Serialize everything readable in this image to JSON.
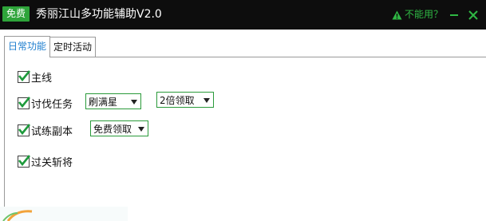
{
  "window": {
    "badge": "免费",
    "title": "秀丽江山多功能辅助V2.0",
    "help_link": "不能用？",
    "accent_color": "#2ea43a"
  },
  "tabs": [
    {
      "label": "日常功能",
      "active": true
    },
    {
      "label": "定时活动",
      "active": false
    }
  ],
  "tasks": [
    {
      "label": "主线",
      "checked": true
    },
    {
      "label": "讨伐任务",
      "checked": true,
      "selects": [
        "刷满星",
        "2倍领取"
      ]
    },
    {
      "label": "试练副本",
      "checked": true,
      "selects": [
        "免费领取"
      ]
    },
    {
      "label": "过关斩将",
      "checked": true
    }
  ],
  "icons": {
    "help": "warning-triangle-icon",
    "minimize": "minimize-icon",
    "close": "close-icon",
    "check": "checkmark-icon"
  }
}
